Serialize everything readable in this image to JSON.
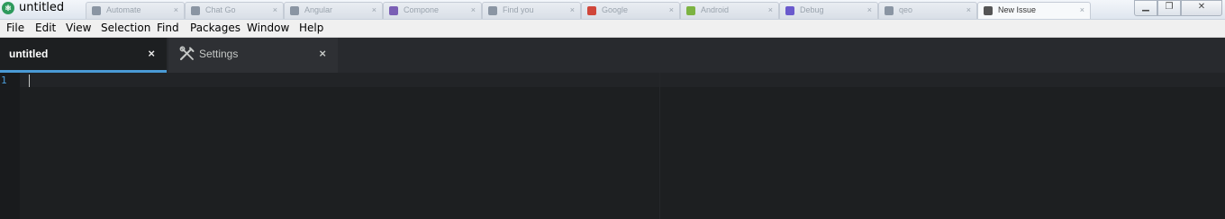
{
  "window": {
    "title": "untitled",
    "app_icon": "atom-icon",
    "background_tabs": [
      "Automate",
      "Chat Go",
      "Angular",
      "Compone",
      "Find you",
      "Google",
      "Android",
      "Debug",
      "qeo",
      "New Issue"
    ]
  },
  "menu": {
    "items": [
      "File",
      "Edit",
      "View",
      "Selection",
      "Find",
      "Packages",
      "Window",
      "Help"
    ]
  },
  "tabs": [
    {
      "label": "untitled",
      "close": "×",
      "active": true
    },
    {
      "label": "Settings",
      "close": "×",
      "icon": "tools-icon",
      "active": false
    }
  ],
  "editor": {
    "line_numbers": [
      "1"
    ]
  },
  "colors": {
    "accent": "#4a9bd6",
    "editor_bg": "#1d1f21",
    "tabbar_bg": "#282a2e"
  }
}
